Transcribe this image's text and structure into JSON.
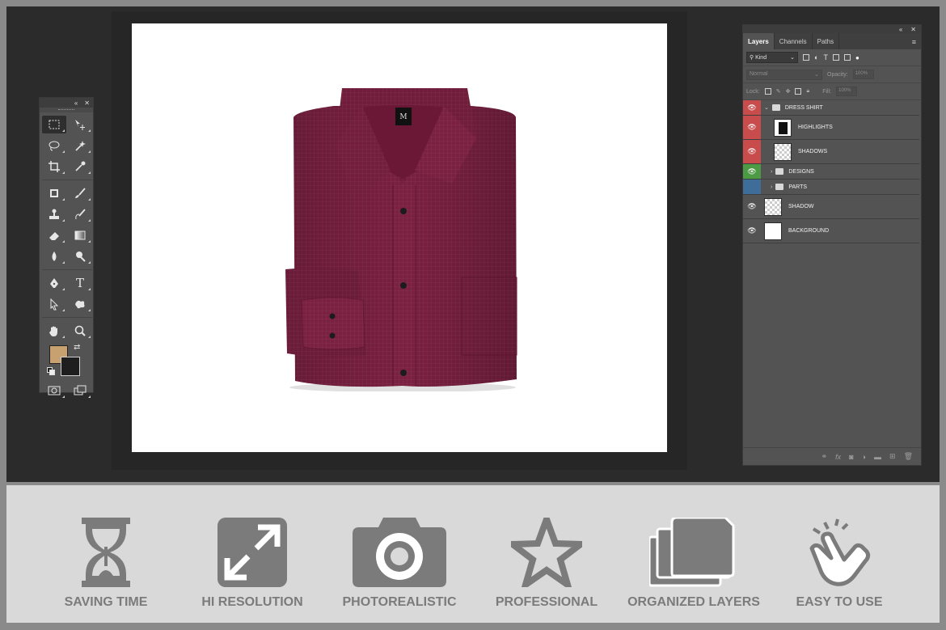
{
  "toolbox": {
    "header_collapse": "«",
    "header_close": "✕",
    "tools": [
      {
        "name": "marquee-tool",
        "icon": "marquee"
      },
      {
        "name": "move-tool",
        "icon": "move"
      },
      {
        "name": "lasso-tool",
        "icon": "lasso"
      },
      {
        "name": "magic-wand-tool",
        "icon": "magic-wand"
      },
      {
        "name": "crop-tool",
        "icon": "crop"
      },
      {
        "name": "eyedropper-tool",
        "icon": "eyedropper"
      },
      {
        "name": "healing-tool",
        "icon": "healing"
      },
      {
        "name": "brush-tool",
        "icon": "brush"
      },
      {
        "name": "stamp-tool",
        "icon": "stamp"
      },
      {
        "name": "history-brush-tool",
        "icon": "history-brush"
      },
      {
        "name": "eraser-tool",
        "icon": "eraser"
      },
      {
        "name": "gradient-tool",
        "icon": "gradient"
      },
      {
        "name": "blur-tool",
        "icon": "blur"
      },
      {
        "name": "dodge-tool",
        "icon": "dodge"
      },
      {
        "name": "pen-tool",
        "icon": "pen"
      },
      {
        "name": "type-tool",
        "icon": "type"
      },
      {
        "name": "path-selection-tool",
        "icon": "path-selection"
      },
      {
        "name": "shape-tool",
        "icon": "shape"
      },
      {
        "name": "hand-tool",
        "icon": "hand"
      },
      {
        "name": "zoom-tool",
        "icon": "zoom"
      }
    ],
    "type_glyph": "T",
    "foreground_color": "#c7a170",
    "background_color": "#1e1e1e"
  },
  "layers_panel": {
    "collapse": "«",
    "close": "✕",
    "tabs": [
      "Layers",
      "Channels",
      "Paths"
    ],
    "active_tab": "Layers",
    "filter_label": "Kind",
    "blend_mode": "Normal",
    "opacity_label": "Opacity:",
    "opacity_value": "100%",
    "lock_label": "Lock:",
    "fill_label": "Fill:",
    "fill_value": "100%",
    "layers": [
      {
        "name": "DRESS SHIRT",
        "type": "group-open",
        "color": "red"
      },
      {
        "name": "HIGHLIGHTS",
        "type": "layer",
        "color": "red"
      },
      {
        "name": "SHADOWS",
        "type": "layer",
        "color": "red"
      },
      {
        "name": "DESIGNS",
        "type": "group",
        "color": "green"
      },
      {
        "name": "PARTS",
        "type": "group",
        "color": "blue"
      },
      {
        "name": "SHADOW",
        "type": "layer",
        "color": "none"
      },
      {
        "name": "BACKGROUND",
        "type": "layer",
        "color": "none"
      }
    ],
    "footer_icons": [
      "link-icon",
      "fx-icon",
      "mask-icon",
      "adjustment-icon",
      "folder-icon",
      "new-layer-icon",
      "trash-icon"
    ]
  },
  "canvas": {
    "background": "#ffffff",
    "shirt_color": "#7a2040",
    "label_text": "M"
  },
  "features": [
    {
      "label": "SAVING TIME",
      "icon": "hourglass-icon"
    },
    {
      "label": "HI RESOLUTION",
      "icon": "expand-icon"
    },
    {
      "label": "PHOTOREALISTIC",
      "icon": "camera-icon"
    },
    {
      "label": "PROFESSIONAL",
      "icon": "star-icon"
    },
    {
      "label": "ORGANIZED LAYERS",
      "icon": "folders-icon"
    },
    {
      "label": "EASY TO USE",
      "icon": "tap-hand-icon"
    }
  ]
}
